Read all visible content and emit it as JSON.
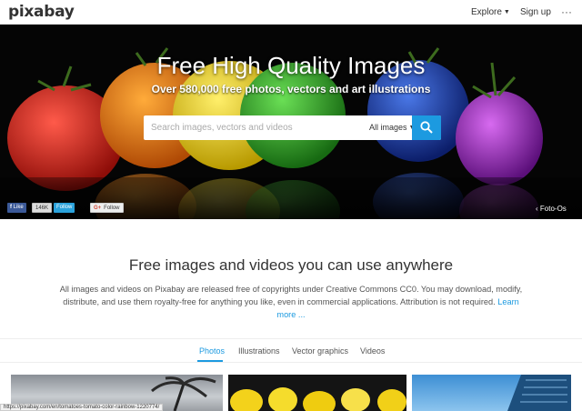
{
  "header": {
    "logo": "pixabay",
    "explore_label": "Explore",
    "signup_label": "Sign up",
    "more_label": "···"
  },
  "hero": {
    "title": "Free High Quality Images",
    "subtitle": "Over 580,000 free photos, vectors and art illustrations",
    "search": {
      "placeholder": "Search images, vectors and videos",
      "value": "",
      "type_selected": "All images"
    },
    "social": {
      "like_label": "Like",
      "like_count": "146K",
      "twitter_label": "Follow",
      "gplus_label": "Follow",
      "gplus_glyph": "G+"
    },
    "credit": "Foto-Os",
    "credit_glyph": "‹"
  },
  "intro": {
    "title": "Free images and videos you can use anywhere",
    "text": "All images and videos on Pixabay are released free of copyrights under Creative Commons CC0. You may download, modify, distribute, and use them royalty-free for anything you like, even in commercial applications. Attribution is not required.",
    "learn_more": "Learn more ..."
  },
  "tabs": [
    {
      "label": "Photos",
      "active": true
    },
    {
      "label": "Illustrations",
      "active": false
    },
    {
      "label": "Vector graphics",
      "active": false
    },
    {
      "label": "Videos",
      "active": false
    }
  ],
  "status_url": "https://pixabay.com/en/tomatoes-tomato-color-rainbow-1220774/",
  "colors": {
    "accent": "#1c9ae0",
    "facebook": "#3b5998",
    "twitter": "#2aa2dc"
  }
}
